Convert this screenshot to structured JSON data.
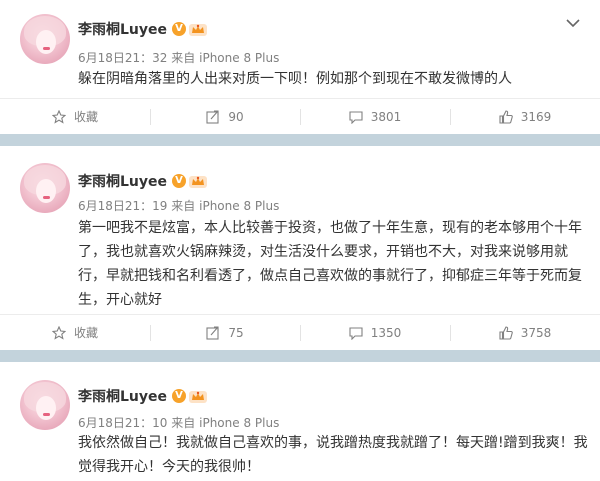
{
  "posts": [
    {
      "username": "李雨桐Luyee",
      "verified_badge": "V",
      "time": "6月18日21：32",
      "source_prefix": "来自",
      "source": "iPhone 8 Plus",
      "text": "躲在阴暗角落里的人出来对质一下呗！例如那个到现在不敢发微博的人",
      "actions": {
        "favorite_label": "收藏",
        "repost_count": "90",
        "comment_count": "3801",
        "like_count": "3169"
      }
    },
    {
      "username": "李雨桐Luyee",
      "verified_badge": "V",
      "time": "6月18日21：19",
      "source_prefix": "来自",
      "source": "iPhone 8 Plus",
      "text": "第一吧我不是炫富，本人比较善于投资，也做了十年生意，现有的老本够用个十年了，我也就喜欢火锅麻辣烫，对生活没什么要求，开销也不大，对我来说够用就行，早就把钱和名利看透了，做点自己喜欢做的事就行了，抑郁症三年等于死而复生，开心就好",
      "actions": {
        "favorite_label": "收藏",
        "repost_count": "75",
        "comment_count": "1350",
        "like_count": "3758"
      }
    },
    {
      "username": "李雨桐Luyee",
      "verified_badge": "V",
      "time": "6月18日21：10",
      "source_prefix": "来自",
      "source": "iPhone 8 Plus",
      "text": "我依然做自己！我就做自己喜欢的事，说我蹭热度我就蹭了！每天蹭!蹭到我爽！我觉得我开心！今天的我很帅！"
    }
  ],
  "colors": {
    "separator": "#c3d3dc",
    "badge": "#f7a22a",
    "meta_text": "#808080",
    "body_text": "#333333"
  },
  "icons": [
    "avatar",
    "verified-badge",
    "crown-icon",
    "chevron-down-icon",
    "star-icon",
    "repost-icon",
    "comment-icon",
    "like-icon"
  ]
}
